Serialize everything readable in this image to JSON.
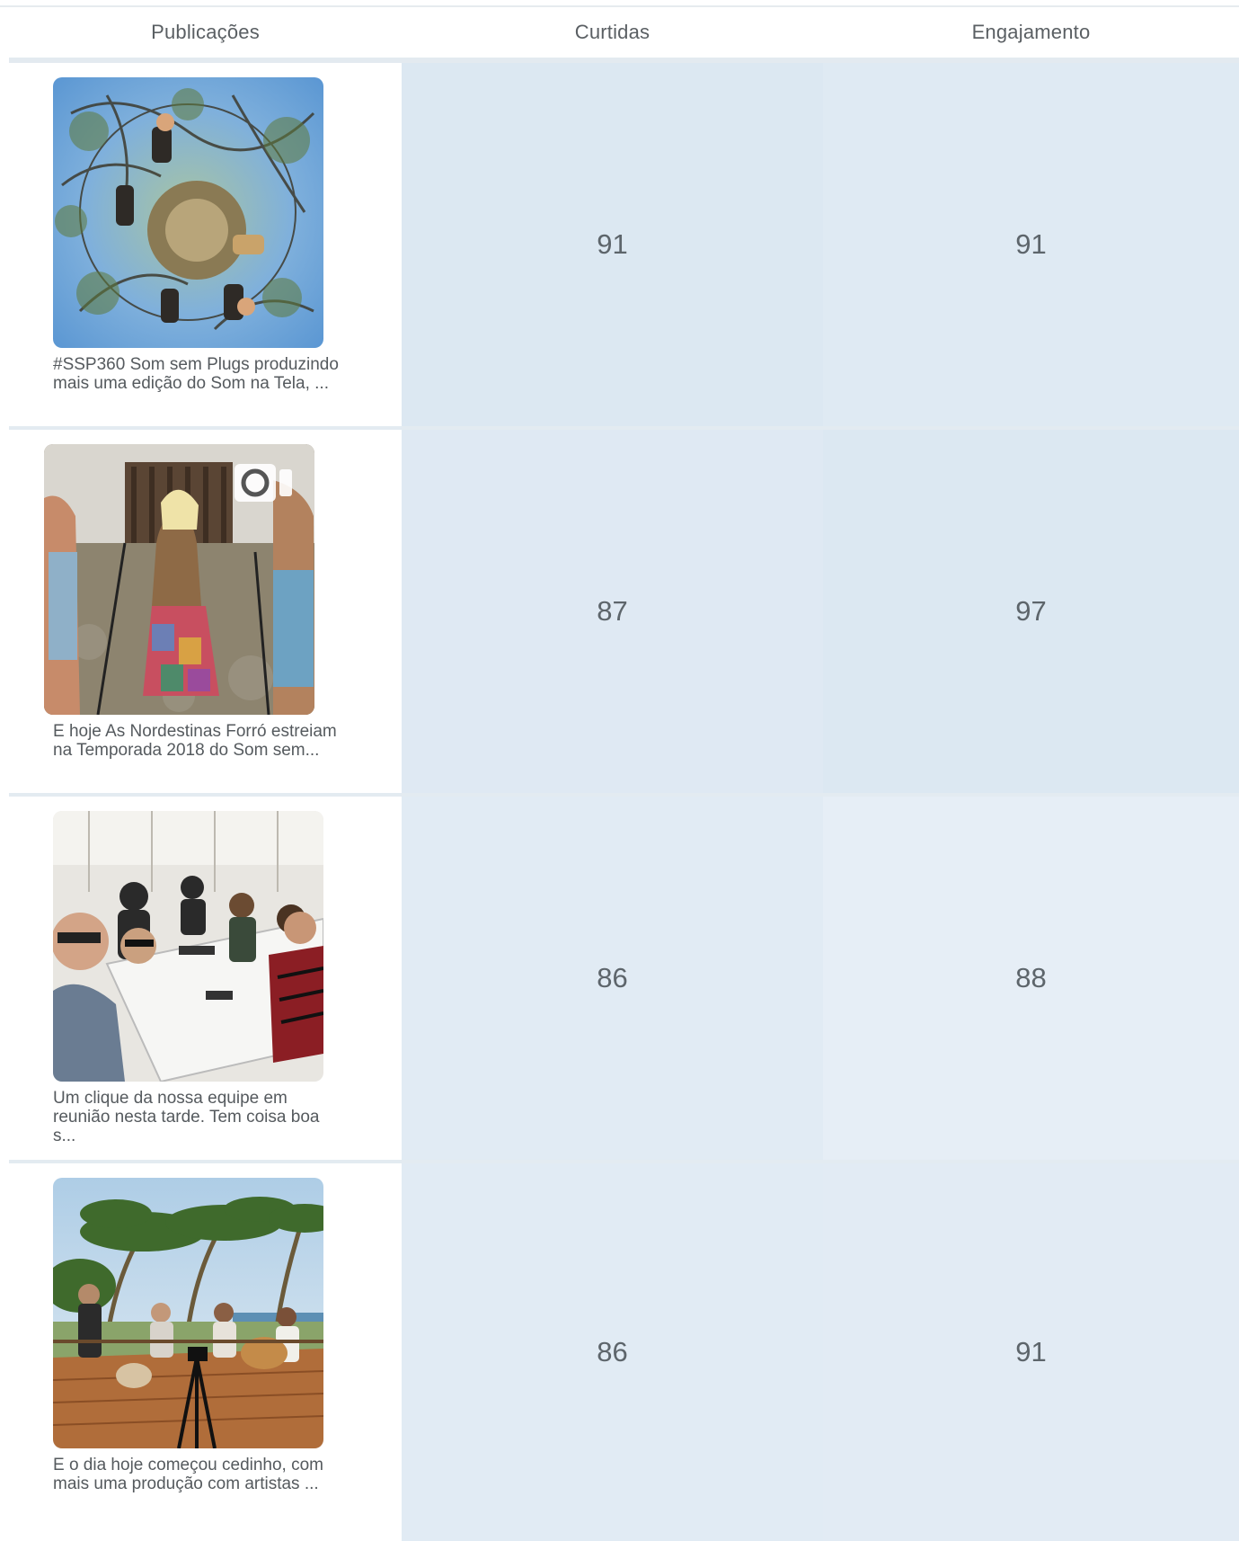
{
  "table": {
    "headers": {
      "publications": "Publicações",
      "likes": "Curtidas",
      "engagement": "Engajamento"
    },
    "rows": [
      {
        "caption": "#SSP360 Som sem Plugs produzindo mais uma edição do Som na Tela, ...",
        "likes": "91",
        "engagement": "91",
        "likes_color": "#dce8f2",
        "engagement_color": "#dfeaf3",
        "thumb": "tiny-planet-photo-musicians-under-tree"
      },
      {
        "caption": "E hoje As Nordestinas Forró estreiam na Temporada 2018 do Som sem...",
        "likes": "87",
        "engagement": "97",
        "likes_color": "#dfe9f3",
        "engagement_color": "#dce8f2",
        "thumb": "video-singer-patchwork-skirt",
        "has_video_icon": true
      },
      {
        "caption": "Um clique da nossa equipe em reunião nesta tarde. Tem coisa boa s...",
        "likes": "86",
        "engagement": "88",
        "likes_color": "#e1ebf4",
        "engagement_color": "#e6eef6",
        "thumb": "team-meeting-selfie"
      },
      {
        "caption": "E o dia hoje começou cedinho, com mais uma produção com artistas ...",
        "likes": "86",
        "engagement": "91",
        "likes_color": "#e1ebf4",
        "engagement_color": "#e2ebf4",
        "thumb": "musicians-on-deck-palm-trees"
      }
    ]
  }
}
